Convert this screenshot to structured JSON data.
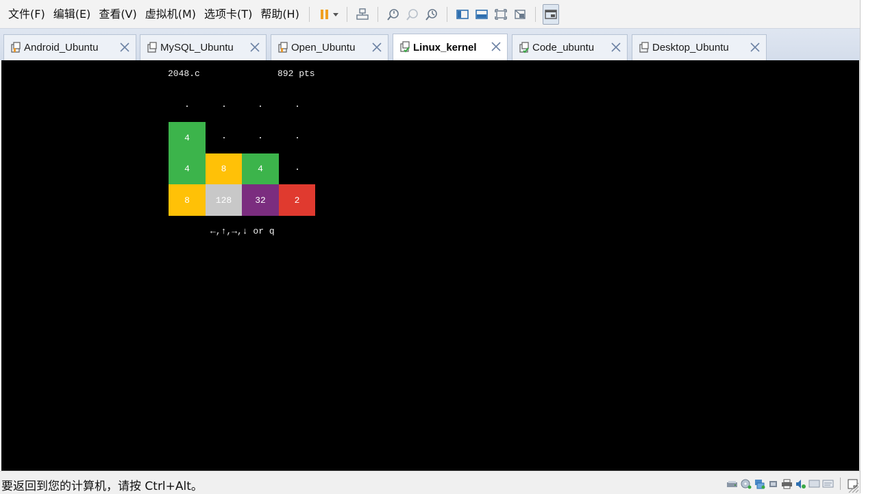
{
  "menu": [
    {
      "id": "file",
      "label": "文件(F)"
    },
    {
      "id": "edit",
      "label": "编辑(E)"
    },
    {
      "id": "view",
      "label": "查看(V)"
    },
    {
      "id": "vm",
      "label": "虚拟机(M)"
    },
    {
      "id": "tabs",
      "label": "选项卡(T)"
    },
    {
      "id": "help",
      "label": "帮助(H)"
    }
  ],
  "toolbar": {
    "icons": [
      "pause-icon",
      "dropdown-arrow-icon",
      "send-keys-icon",
      "snapshot-take-icon",
      "snapshot-revert-icon",
      "snapshot-manager-icon",
      "show-library-icon",
      "thumbnail-bar-icon",
      "fullscreen-icon",
      "unity-icon",
      "console-view-icon"
    ]
  },
  "tabs": [
    {
      "label": "Android_Ubuntu",
      "active": false
    },
    {
      "label": "MySQL_Ubuntu",
      "active": false
    },
    {
      "label": "Open_Ubuntu",
      "active": false
    },
    {
      "label": "Linux_kernel",
      "active": true
    },
    {
      "label": "Code_ubuntu",
      "active": false
    },
    {
      "label": "Desktop_Ubuntu",
      "active": false
    }
  ],
  "game": {
    "title": "2048.c",
    "score": "892 pts",
    "hint": "←,↑,→,↓ or q",
    "grid": [
      [
        "",
        "",
        "",
        ""
      ],
      [
        "4",
        "",
        "",
        ""
      ],
      [
        "4",
        "8",
        "4",
        ""
      ],
      [
        "8",
        "128",
        "32",
        "2"
      ]
    ],
    "colors": {
      "2": "#e03a2f",
      "4": "#3cb44b",
      "8": "#ffc107",
      "32": "#7b2d7f",
      "128": "#c8c8c8"
    }
  },
  "status": {
    "message": "要返回到您的计算机，请按 Ctrl+Alt。",
    "tray_icons": [
      "hard-disk-icon",
      "cd-dvd-icon",
      "network-icon",
      "usb-icon",
      "printer-icon",
      "sound-icon",
      "display-icon",
      "message-icon",
      "notes-icon"
    ]
  }
}
